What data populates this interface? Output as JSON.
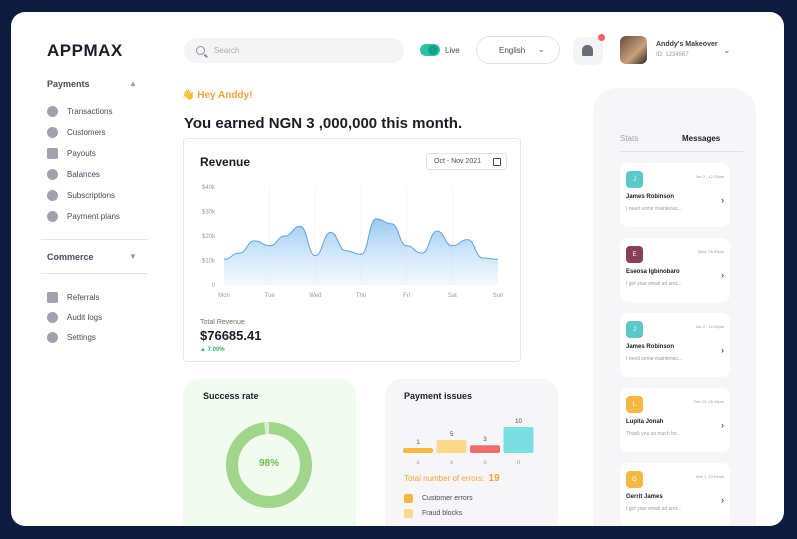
{
  "app": {
    "logo": "APPMAX"
  },
  "sidebar": {
    "payments_header": "Payments",
    "payments_items": [
      {
        "label": "Transactions",
        "icon": "transactions-icon"
      },
      {
        "label": "Customers",
        "icon": "customers-icon"
      },
      {
        "label": "Payouts",
        "icon": "payouts-icon"
      },
      {
        "label": "Balances",
        "icon": "balances-icon"
      },
      {
        "label": "Subscriptions",
        "icon": "subscriptions-icon"
      },
      {
        "label": "Payment plans",
        "icon": "payment-plans-icon"
      }
    ],
    "commerce_header": "Commerce",
    "other_items": [
      {
        "label": "Referrals",
        "icon": "referrals-icon"
      },
      {
        "label": "Audit logs",
        "icon": "audit-logs-icon"
      },
      {
        "label": "Settings",
        "icon": "settings-icon"
      }
    ]
  },
  "topbar": {
    "search_placeholder": "Search",
    "live_label": "Live",
    "language": "English",
    "user_name": "Anddy's Makeover",
    "user_id": "ID: 1234567"
  },
  "main": {
    "greeting": "Hey Anddy!",
    "headline": "You earned NGN 3 ,000,000 this month.",
    "revenue": {
      "title": "Revenue",
      "date_range": "Oct - Nov 2021",
      "total_label": "Total Revenue",
      "total_value": "$76685.41",
      "change": "7.00%"
    },
    "success": {
      "title": "Success rate",
      "value": "98%",
      "rate": 0.98
    },
    "payment_issues": {
      "title": "Payment issues",
      "total_label": "Total number of errors:",
      "total_value": "19",
      "legend": [
        {
          "label": "Customer errors",
          "color": "#f5b942"
        },
        {
          "label": "Fraud blocks",
          "color": "#fbd88a"
        }
      ]
    }
  },
  "chart_data": [
    {
      "type": "area",
      "title": "Revenue",
      "categories": [
        "Mon",
        "Tue",
        "Wed",
        "Thu",
        "Fri",
        "Sat",
        "Sun"
      ],
      "y_ticks": [
        "$40k",
        "$30k",
        "$20k",
        "$10k",
        "0"
      ],
      "ylim": [
        0,
        40000
      ],
      "series": [
        {
          "values": [
            10500,
            13000,
            18000,
            16000,
            20000,
            24000,
            12000,
            21500,
            14000,
            12500,
            27000,
            25000,
            16000,
            13000,
            22000,
            16000,
            18500,
            11000,
            10500
          ]
        }
      ],
      "color": "#5aa3e8"
    },
    {
      "type": "bar",
      "title": "Payment issues",
      "categories": [
        "s",
        "x",
        "o",
        "n"
      ],
      "values": [
        1,
        5,
        3,
        10
      ],
      "colors": [
        "#f5b942",
        "#fbd88a",
        "#f06c6c",
        "#7bdde4"
      ]
    }
  ],
  "right_panel": {
    "tabs": [
      {
        "label": "Stats"
      },
      {
        "label": "Messages"
      }
    ],
    "messages": [
      {
        "initial": "J",
        "color": "#5cc8c8",
        "time": "Jan 2 , 12:20pm",
        "name": "James Robinson",
        "preview": "I need some maintenac..."
      },
      {
        "initial": "E",
        "color": "#8a3e5a",
        "time": "Wed, 06:00pm",
        "name": "Eseosa Igbinobaro",
        "preview": "I got your email ad and..."
      },
      {
        "initial": "J",
        "color": "#5cc8c8",
        "time": "Jan 2 , 12:20pm",
        "name": "James Robinson",
        "preview": "I need some maintenac..."
      },
      {
        "initial": "L",
        "color": "#f5b942",
        "time": "Feb 23, 06:10pm",
        "name": "Lupita Jonah",
        "preview": "Thank you so much for..."
      },
      {
        "initial": "G",
        "color": "#f5b942",
        "time": "Mar 1, 10:04am",
        "name": "Gerrit James",
        "preview": "I got your email ad and..."
      }
    ]
  }
}
